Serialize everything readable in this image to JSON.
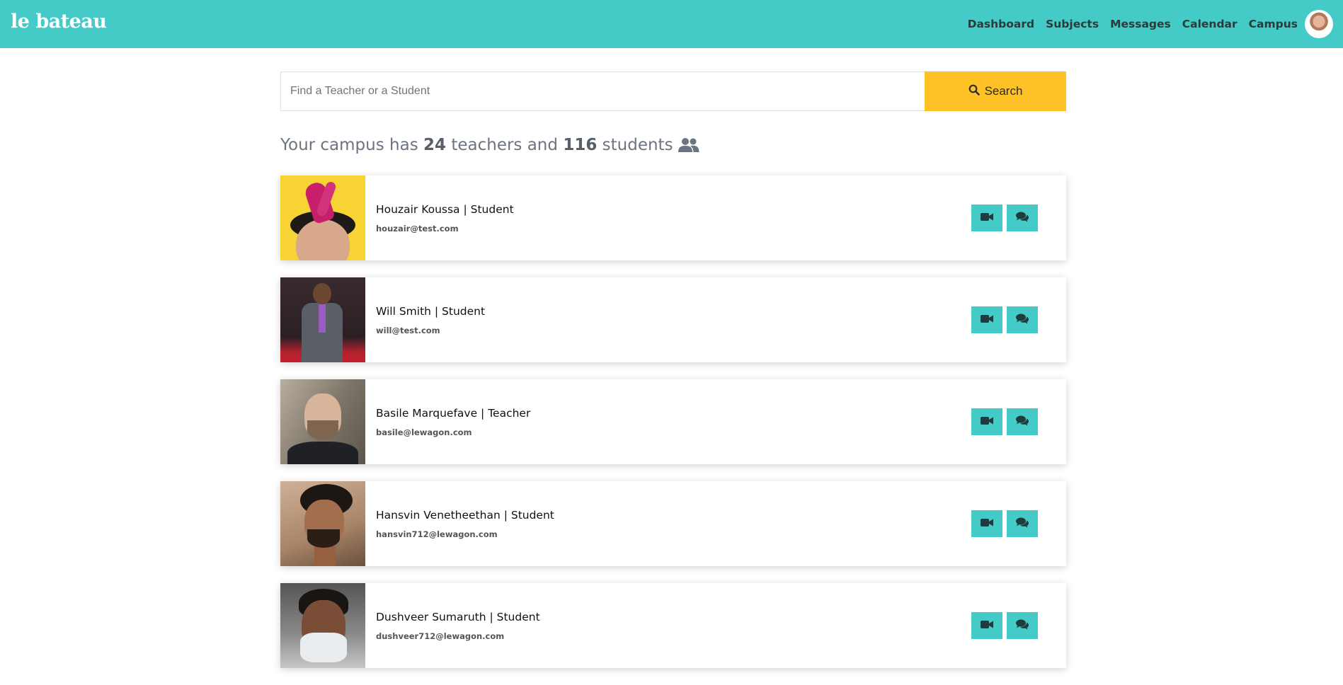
{
  "navbar": {
    "brand": "le bateau",
    "links": [
      "Dashboard",
      "Subjects",
      "Messages",
      "Calendar",
      "Campus"
    ]
  },
  "search": {
    "placeholder": "Find a Teacher or a Student",
    "value": "",
    "button_label": "Search"
  },
  "summary": {
    "prefix": "Your campus has",
    "teachers_count": "24",
    "middle": "teachers and",
    "students_count": "116",
    "suffix": "students"
  },
  "people": [
    {
      "name": "Houzair Koussa | Student",
      "email": "houzair@test.com"
    },
    {
      "name": "Will Smith | Student",
      "email": "will@test.com"
    },
    {
      "name": "Basile Marquefave | Teacher",
      "email": "basile@lewagon.com"
    },
    {
      "name": "Hansvin Venetheethan | Student",
      "email": "hansvin712@lewagon.com"
    },
    {
      "name": "Dushveer Sumaruth | Student",
      "email": "dushveer712@lewagon.com"
    }
  ],
  "colors": {
    "navbar": "#44cbc7",
    "search_button": "#fec126",
    "action_button": "#44cbc7"
  },
  "icons": {
    "search": "search-icon",
    "people": "users-icon",
    "video": "video-camera-icon",
    "chat": "comments-icon"
  }
}
